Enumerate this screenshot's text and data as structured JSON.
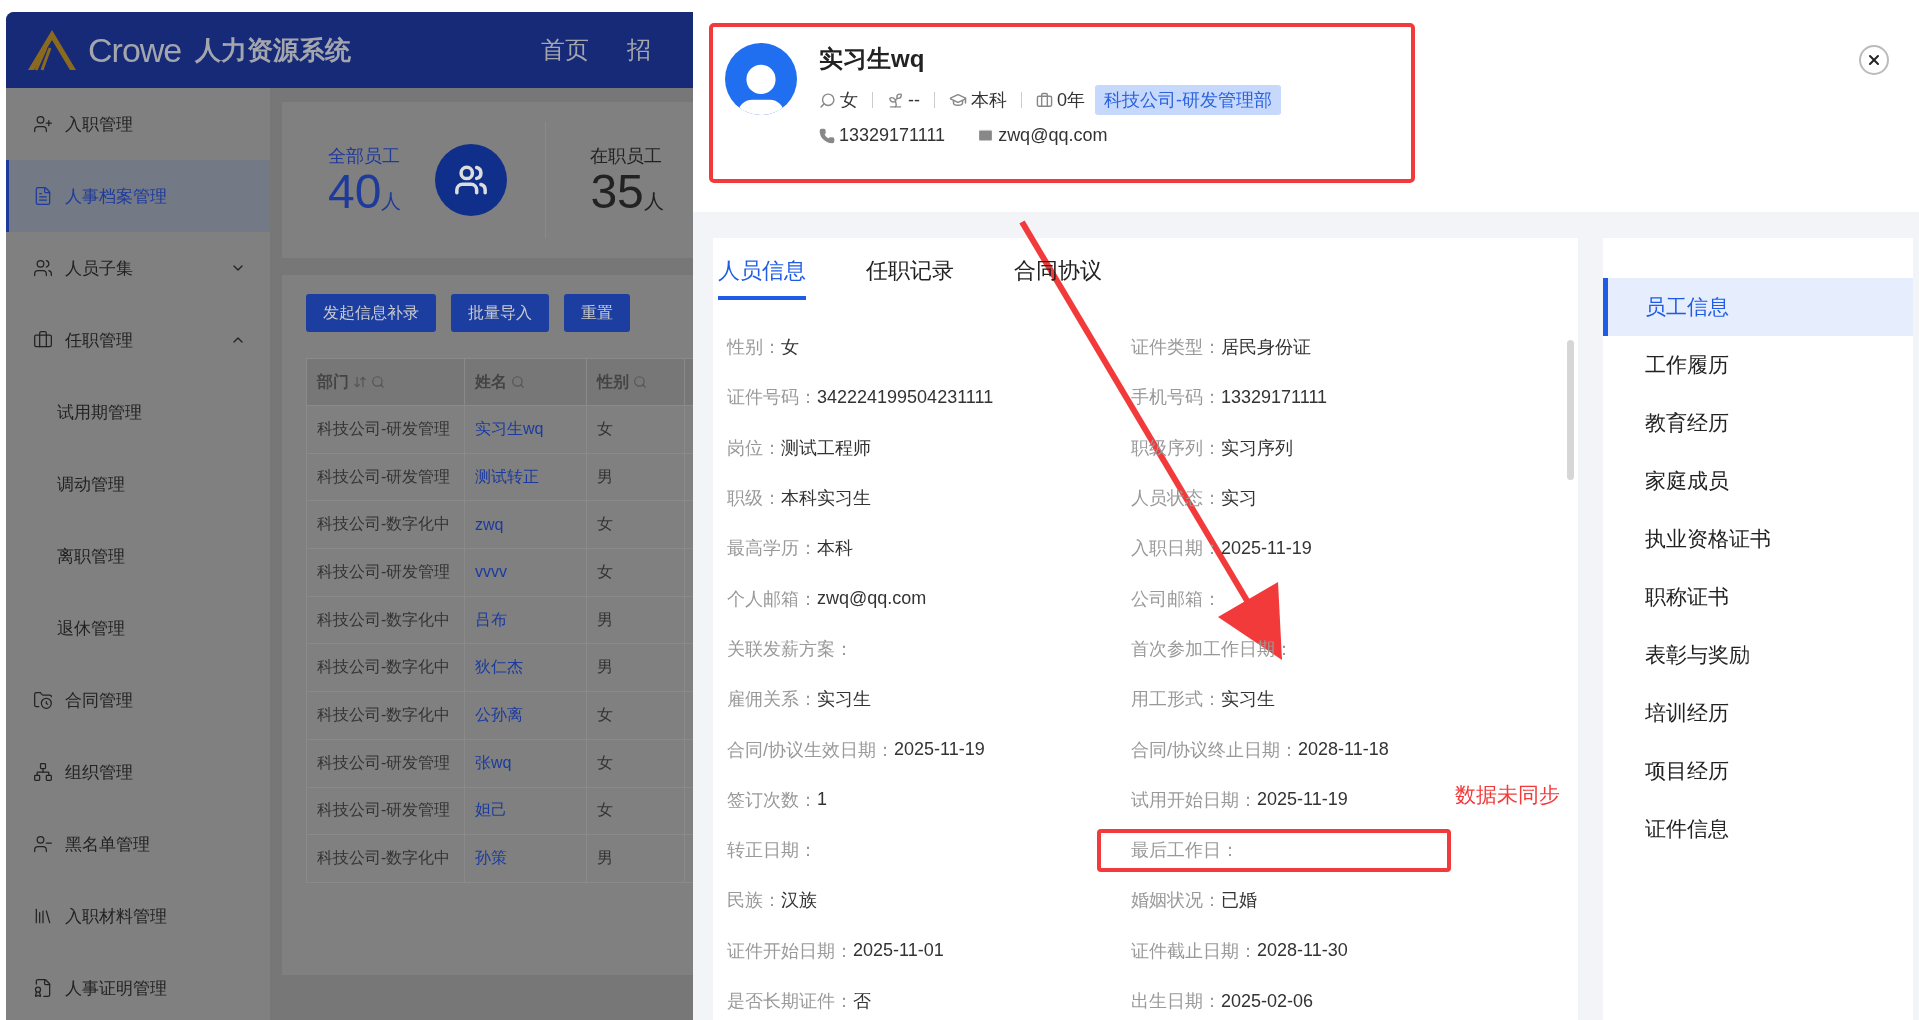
{
  "header": {
    "logo_text": "Crowe",
    "system_name": "人力资源系统",
    "nav": [
      {
        "label": "首页"
      },
      {
        "label": "招"
      }
    ]
  },
  "sidebar": {
    "items": [
      {
        "label": "入职管理",
        "selected": false
      },
      {
        "label": "人事档案管理",
        "selected": true
      },
      {
        "label": "人员子集",
        "selected": false,
        "expanded": false
      },
      {
        "label": "任职管理",
        "selected": false,
        "expanded": true,
        "children": [
          {
            "label": "试用期管理",
            "selected": false
          },
          {
            "label": "调动管理",
            "selected": false
          },
          {
            "label": "离职管理",
            "selected": false
          },
          {
            "label": "退休管理",
            "selected": false
          }
        ]
      },
      {
        "label": "合同管理",
        "selected": false
      },
      {
        "label": "组织管理",
        "selected": false
      },
      {
        "label": "黑名单管理",
        "selected": false
      },
      {
        "label": "入职材料管理",
        "selected": false
      },
      {
        "label": "人事证明管理",
        "selected": false
      }
    ]
  },
  "stats": [
    {
      "label": "全部员工",
      "value": "40",
      "unit": "人",
      "selected": true
    },
    {
      "label": "在职员工",
      "value": "35",
      "unit": "人",
      "selected": false
    }
  ],
  "toolbar": {
    "buttons": [
      "发起信息补录",
      "批量导入",
      "重置"
    ]
  },
  "table": {
    "columns": [
      {
        "label": "部门",
        "sortable": true
      },
      {
        "label": "姓名",
        "sortable": false
      },
      {
        "label": "性别",
        "sortable": false
      }
    ],
    "rows": [
      [
        "科技公司-研发管理",
        "实习生wq",
        "女"
      ],
      [
        "科技公司-研发管理",
        "测试转正",
        "男"
      ],
      [
        "科技公司-数字化中",
        "zwq",
        "女"
      ],
      [
        "科技公司-研发管理",
        "vvvv",
        "女"
      ],
      [
        "科技公司-数字化中",
        "吕布",
        "男"
      ],
      [
        "科技公司-数字化中",
        "狄仁杰",
        "男"
      ],
      [
        "科技公司-数字化中",
        "公孙离",
        "女"
      ],
      [
        "科技公司-研发管理",
        "张wq",
        "女"
      ],
      [
        "科技公司-研发管理",
        "妲己",
        "女"
      ],
      [
        "科技公司-数字化中",
        "孙策",
        "男"
      ]
    ]
  },
  "drawer": {
    "profile": {
      "name": "实习生wq",
      "highlighted": true,
      "gender": "女",
      "meta_2": "--",
      "education": "本科",
      "years": "0年",
      "department": "科技公司-研发管理部",
      "phone": "13329171111",
      "email": "zwq@qq.com"
    },
    "tabs": [
      {
        "label": "人员信息",
        "selected": true
      },
      {
        "label": "任职记录",
        "selected": false
      },
      {
        "label": "合同协议",
        "selected": false
      }
    ],
    "fields": [
      {
        "label": "性别：",
        "value": "女",
        "highlighted": false
      },
      {
        "label": "证件类型：",
        "value": "居民身份证",
        "highlighted": false
      },
      {
        "label": "证件号码：",
        "value": "342224199504231111",
        "highlighted": false
      },
      {
        "label": "手机号码：",
        "value": "13329171111",
        "highlighted": false
      },
      {
        "label": "岗位：",
        "value": "测试工程师",
        "highlighted": false
      },
      {
        "label": "职级序列：",
        "value": "实习序列",
        "highlighted": false
      },
      {
        "label": "职级：",
        "value": "本科实习生",
        "highlighted": false
      },
      {
        "label": "人员状态：",
        "value": "实习",
        "highlighted": false
      },
      {
        "label": "最高学历：",
        "value": "本科",
        "highlighted": false
      },
      {
        "label": "入职日期：",
        "value": "2025-11-19",
        "highlighted": false
      },
      {
        "label": "个人邮箱：",
        "value": "zwq@qq.com",
        "highlighted": false
      },
      {
        "label": "公司邮箱：",
        "highlighted": false
      },
      {
        "label": "关联发薪方案：",
        "highlighted": false
      },
      {
        "label": "首次参加工作日期：",
        "highlighted": false
      },
      {
        "label": "雇佣关系：",
        "value": "实习生",
        "highlighted": false
      },
      {
        "label": "用工形式：",
        "value": "实习生",
        "highlighted": false
      },
      {
        "label": "合同/协议生效日期：",
        "value": "2025-11-19",
        "highlighted": false
      },
      {
        "label": "合同/协议终止日期：",
        "value": "2028-11-18",
        "highlighted": false
      },
      {
        "label": "签订次数：",
        "value": "1",
        "highlighted": false
      },
      {
        "label": "试用开始日期：",
        "value": "2025-11-19",
        "highlighted": false
      },
      {
        "label": "转正日期：",
        "highlighted": false
      },
      {
        "label": "最后工作日：",
        "highlighted": true,
        "note": "数据未同步"
      },
      {
        "label": "民族：",
        "value": "汉族",
        "highlighted": false
      },
      {
        "label": "婚姻状况：",
        "value": "已婚",
        "highlighted": false
      },
      {
        "label": "证件开始日期：",
        "value": "2025-11-01",
        "highlighted": false
      },
      {
        "label": "证件截止日期：",
        "value": "2028-11-30",
        "highlighted": false
      },
      {
        "label": "是否长期证件：",
        "value": "否",
        "highlighted": false
      },
      {
        "label": "出生日期：",
        "value": "2025-02-06",
        "highlighted": false
      }
    ],
    "side_nav": [
      {
        "label": "员工信息",
        "selected": true
      },
      {
        "label": "工作履历",
        "selected": false
      },
      {
        "label": "教育经历",
        "selected": false
      },
      {
        "label": "家庭成员",
        "selected": false
      },
      {
        "label": "执业资格证书",
        "selected": false
      },
      {
        "label": "职称证书",
        "selected": false
      },
      {
        "label": "表彰与奖励",
        "selected": false
      },
      {
        "label": "培训经历",
        "selected": false
      },
      {
        "label": "项目经历",
        "selected": false
      },
      {
        "label": "证件信息",
        "selected": false
      }
    ]
  }
}
